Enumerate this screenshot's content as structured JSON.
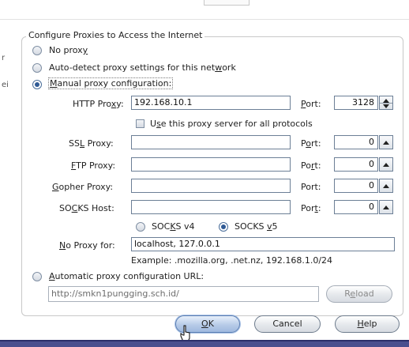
{
  "group_title": "Configure Proxies to Access the Internet",
  "modes": {
    "no_proxy": {
      "pre": "No prox",
      "u": "y",
      "post": "",
      "selected": false
    },
    "auto_detect": {
      "pre": "Auto-detect proxy settings for this net",
      "u": "w",
      "post": "ork",
      "selected": false
    },
    "manual": {
      "pre": "",
      "u": "M",
      "post": "anual proxy configuration:",
      "selected": true
    },
    "auto_url": {
      "pre": "",
      "u": "A",
      "post": "utomatic proxy configuration URL:",
      "selected": false
    }
  },
  "http": {
    "label_pre": "HTTP Pro",
    "label_u": "x",
    "label_post": "y:",
    "value": "192.168.10.1",
    "port_label": "Port:",
    "port_u": "P",
    "port_rest": "ort:",
    "port": "3128"
  },
  "share_all": {
    "pre": "U",
    "u": "s",
    "post": "e this proxy server for all protocols",
    "checked": false
  },
  "ssl": {
    "label_pre": "SS",
    "label_u": "L",
    "label_post": " Proxy:",
    "value": "",
    "port_pre": "P",
    "port_u": "o",
    "port_post": "rt:",
    "port": "0"
  },
  "ftp": {
    "label_pre": "",
    "label_u": "F",
    "label_post": "TP Proxy:",
    "value": "",
    "port_pre": "Po",
    "port_u": "r",
    "port_post": "t:",
    "port": "0"
  },
  "gopher": {
    "label_pre": "",
    "label_u": "G",
    "label_post": "opher Proxy:",
    "value": "",
    "port_label": "Port:",
    "port": "0"
  },
  "socks": {
    "label_pre": "SO",
    "label_u": "C",
    "label_post": "KS Host:",
    "value": "",
    "port_pre": "Por",
    "port_u": "t",
    "port_post": ":",
    "port": "0"
  },
  "socks_v4": {
    "pre": "SOC",
    "u": "K",
    "post": "S v4",
    "selected": false
  },
  "socks_v5": {
    "pre": "SOCKS ",
    "u": "v",
    "post": "5",
    "selected": true
  },
  "no_proxy_for": {
    "label_pre": "",
    "label_u": "N",
    "label_post": "o Proxy for:",
    "value": "localhost, 127.0.0.1"
  },
  "example": "Example: .mozilla.org, .net.nz, 192.168.1.0/24",
  "auto_url_value": "http://smkn1pungging.sch.id/",
  "buttons": {
    "reload": {
      "pre": "R",
      "u": "e",
      "post": "load"
    },
    "ok": {
      "pre": "",
      "u": "O",
      "post": "K"
    },
    "cancel": "Cancel",
    "help": {
      "pre": "",
      "u": "H",
      "post": "elp"
    }
  },
  "left_edge": [
    "r",
    "ei"
  ],
  "colors": {
    "selected_radio": "#2f5a95",
    "field_border": "#6c7f96",
    "bottom_bar": "#4a4f8e"
  },
  "icons": {
    "cursor": "mouse-pointer-icon",
    "spin": "spin-arrows-icon"
  }
}
